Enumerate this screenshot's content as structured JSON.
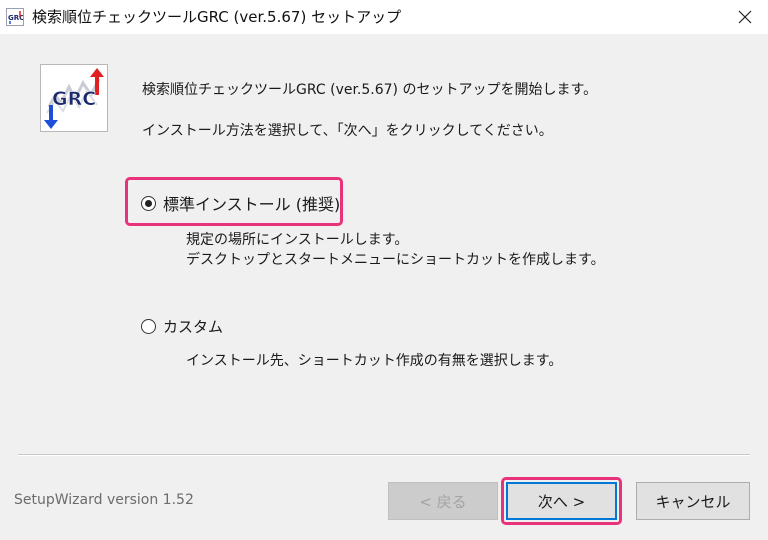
{
  "window": {
    "title": "検索順位チェックツールGRC (ver.5.67)  セットアップ"
  },
  "logo": {
    "text": "GRC",
    "accent_colors": {
      "up_arrow": "#e02020",
      "down_arrow": "#1e4fd8",
      "text": "#1c2a6a"
    }
  },
  "intro": {
    "line1": "検索順位チェックツールGRC (ver.5.67) のセットアップを開始します。",
    "line2": "インストール方法を選択して、「次へ」をクリックしてください。"
  },
  "options": {
    "standard": {
      "label": "標準インストール (推奨)",
      "selected": true,
      "description_line1": "規定の場所にインストールします。",
      "description_line2": "デスクトップとスタートメニューにショートカットを作成します。"
    },
    "custom": {
      "label": "カスタム",
      "selected": false,
      "description": "インストール先、ショートカット作成の有無を選択します。"
    }
  },
  "footer": {
    "version": "SetupWizard version 1.52",
    "back_label": "< 戻る",
    "back_enabled": false,
    "next_label": "次へ >",
    "cancel_label": "キャンセル"
  },
  "annotations": {
    "highlight_color": "#e8337a",
    "focus_color": "#0078d7"
  }
}
